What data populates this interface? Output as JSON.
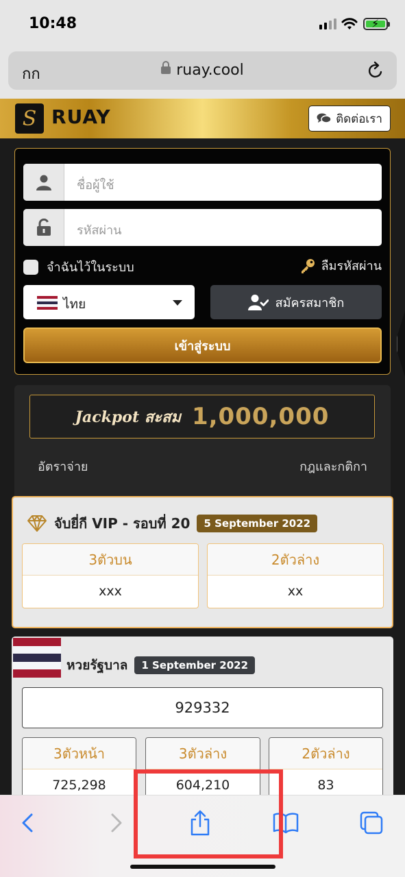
{
  "status_bar": {
    "time": "10:48"
  },
  "browser": {
    "text_size_label": "กก",
    "url": "ruay.cool"
  },
  "header": {
    "logo_letter": "S",
    "brand": "RUAY",
    "contact_label": "ติดต่อเรา"
  },
  "login": {
    "username_placeholder": "ชื่อผู้ใช้",
    "password_placeholder": "รหัสผ่าน",
    "remember_label": "จำฉันไว้ในระบบ",
    "forgot_label": "ลืมรหัสผ่าน",
    "language": "ไทย",
    "register_label": "สมัครสมาชิก",
    "login_label": "เข้าสู่ระบบ"
  },
  "jackpot": {
    "label": "Jackpot สะสม",
    "value": "1,000,000",
    "link_left": "อัตราจ่าย",
    "link_right": "กฎและกติกา"
  },
  "vip": {
    "title": "จับยี่กี VIP - รอบที่ 20",
    "date": "5 September 2022",
    "results": [
      {
        "label": "3ตัวบน",
        "value": "xxx"
      },
      {
        "label": "2ตัวล่าง",
        "value": "xx"
      }
    ]
  },
  "thai_lottery": {
    "title": "หวยรัฐบาล",
    "date": "1 September 2022",
    "first_prize": "929332",
    "results": [
      {
        "label": "3ตัวหน้า",
        "value": "725,298"
      },
      {
        "label": "3ตัวล่าง",
        "value": "604,210"
      },
      {
        "label": "2ตัวล่าง",
        "value": "83"
      }
    ]
  },
  "colors": {
    "gold": "#c7993a",
    "accent": "#c98b2d",
    "highlight": "#ee3a3a",
    "safari_blue": "#2f7cf6"
  },
  "toolbar_icons": [
    "back-icon",
    "forward-icon",
    "share-icon",
    "bookmarks-icon",
    "tabs-icon"
  ]
}
